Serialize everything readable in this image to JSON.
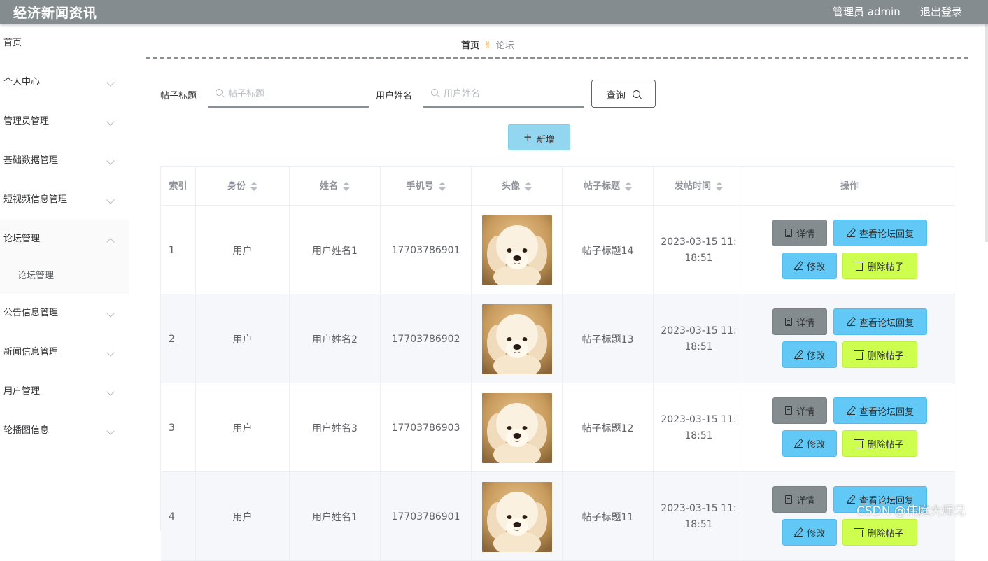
{
  "header": {
    "app_title": "经济新闻资讯",
    "user_label": "管理员 admin",
    "logout_label": "退出登录"
  },
  "sidebar": {
    "items": [
      {
        "label": "首页"
      },
      {
        "label": "个人中心"
      },
      {
        "label": "管理员管理"
      },
      {
        "label": "基础数据管理"
      },
      {
        "label": "短视频信息管理"
      },
      {
        "label": "论坛管理",
        "open": true
      },
      {
        "label": "公告信息管理"
      },
      {
        "label": "新闻信息管理"
      },
      {
        "label": "用户管理"
      },
      {
        "label": "轮播图信息"
      }
    ],
    "submenu": {
      "label": "论坛管理"
    }
  },
  "breadcrumb": {
    "home": "首页",
    "current": "论坛"
  },
  "search": {
    "title_label": "帖子标题",
    "title_placeholder": "帖子标题",
    "user_label": "用户姓名",
    "user_placeholder": "用户姓名",
    "query_label": "查询",
    "add_label": "新增"
  },
  "table": {
    "columns": [
      "索引",
      "身份",
      "姓名",
      "手机号",
      "头像",
      "帖子标题",
      "发帖时间",
      "操作"
    ],
    "actions": {
      "detail": "详情",
      "reply": "查看论坛回复",
      "edit": "修改",
      "delete": "删除帖子"
    },
    "rows": [
      {
        "index": "1",
        "role": "用户",
        "name": "用户姓名1",
        "phone": "17703786901",
        "title": "帖子标题14",
        "time_line1": "2023-03-15 11:",
        "time_line2": "18:51"
      },
      {
        "index": "2",
        "role": "用户",
        "name": "用户姓名2",
        "phone": "17703786902",
        "title": "帖子标题13",
        "time_line1": "2023-03-15 11:",
        "time_line2": "18:51"
      },
      {
        "index": "3",
        "role": "用户",
        "name": "用户姓名3",
        "phone": "17703786903",
        "title": "帖子标题12",
        "time_line1": "2023-03-15 11:",
        "time_line2": "18:51"
      },
      {
        "index": "4",
        "role": "用户",
        "name": "用户姓名1",
        "phone": "17703786901",
        "title": "帖子标题11",
        "time_line1": "2023-03-15 11:",
        "time_line2": "18:51"
      }
    ]
  },
  "watermark": "CSDN @伟庭大师兄",
  "colors": {
    "header": "#848c90",
    "detail_button": "#848c90",
    "reply_button": "#62c9f6",
    "delete_button": "#ceff4f",
    "add_button": "#92d6f0"
  }
}
